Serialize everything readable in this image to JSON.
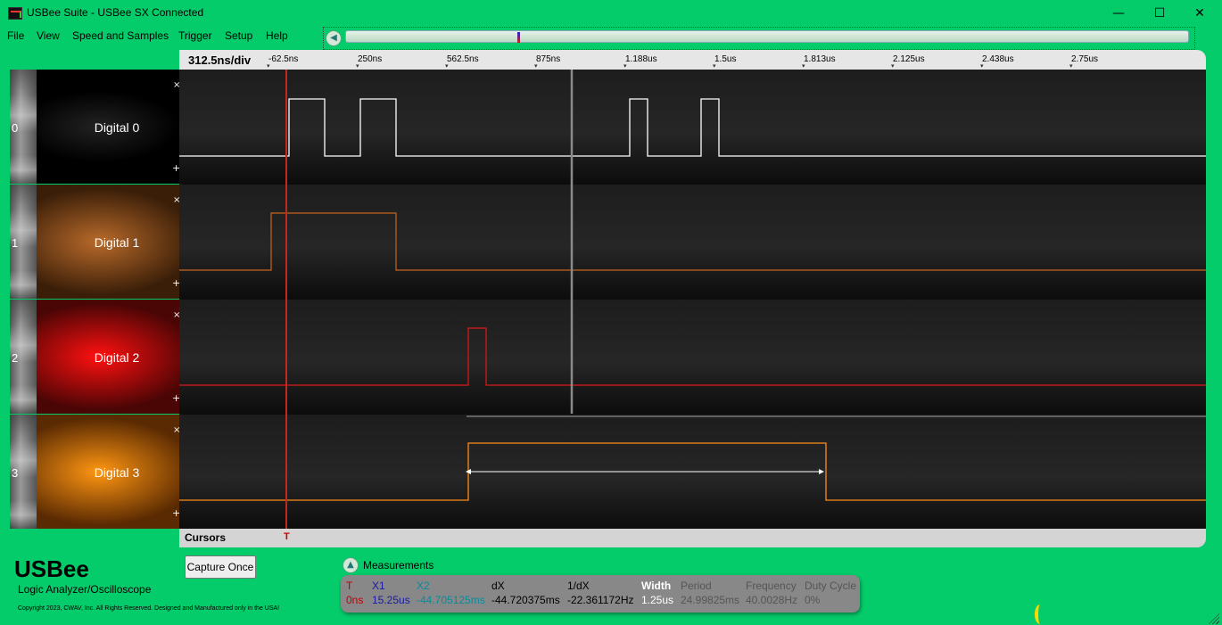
{
  "window": {
    "title": "USBee Suite - USBee SX Connected",
    "minimize": "—",
    "maximize": "☐",
    "close": "✕"
  },
  "menu": [
    "File",
    "View",
    "Speed and Samples",
    "Trigger",
    "Setup",
    "Help"
  ],
  "overview": {
    "back_icon": "◀"
  },
  "timebase": {
    "div_label": "312.5ns/div",
    "ticks": [
      "-62.5ns",
      "250ns",
      "562.5ns",
      "875ns",
      "1.188us",
      "1.5us",
      "1.813us",
      "2.125us",
      "2.438us",
      "2.75us"
    ]
  },
  "channels": [
    {
      "number": "0",
      "name": "Digital 0",
      "color": "#ffffff",
      "bg": "#000000",
      "checked": true
    },
    {
      "number": "1",
      "name": "Digital 1",
      "color": "#c8641e",
      "bg": "#8a4a18",
      "checked": false
    },
    {
      "number": "2",
      "name": "Digital 2",
      "color": "#e01818",
      "bg": "#ff1414",
      "checked": false
    },
    {
      "number": "3",
      "name": "Digital 3",
      "color": "#ff8c1a",
      "bg": "#ff8c10",
      "checked": false
    }
  ],
  "channel_controls": {
    "collapse": "×",
    "expand": "+"
  },
  "cursors": {
    "label": "Cursors",
    "trigger_marker": "T"
  },
  "branding": {
    "name": "USBee",
    "subtitle": "Logic Analyzer/Oscilloscope",
    "copyright": "Copyright 2023, CWAV, Inc. All Rights Reserved. Designed and Manufactured only in the USA!"
  },
  "capture_button": "Capture Once",
  "measurements": {
    "title": "Measurements",
    "toggle_icon": "▲",
    "columns": [
      {
        "label": "T",
        "value": "0ns",
        "color": "#c00000"
      },
      {
        "label": "X1",
        "value": "15.25us",
        "color": "#1a1aa0"
      },
      {
        "label": "X2",
        "value": "-44.705125ms",
        "color": "#0a8a9a"
      },
      {
        "label": "dX",
        "value": "-44.720375ms",
        "color": "#000000"
      },
      {
        "label": "1/dX",
        "value": "-22.361172Hz",
        "color": "#000000"
      },
      {
        "label": "Width",
        "value": "1.25us",
        "color": "#ffffff"
      },
      {
        "label": "Period",
        "value": "24.99825ms",
        "color": "#555555"
      },
      {
        "label": "Frequency",
        "value": "40.0028Hz",
        "color": "#555555"
      },
      {
        "label": "Duty Cycle",
        "value": "0%",
        "color": "#555555"
      }
    ]
  }
}
